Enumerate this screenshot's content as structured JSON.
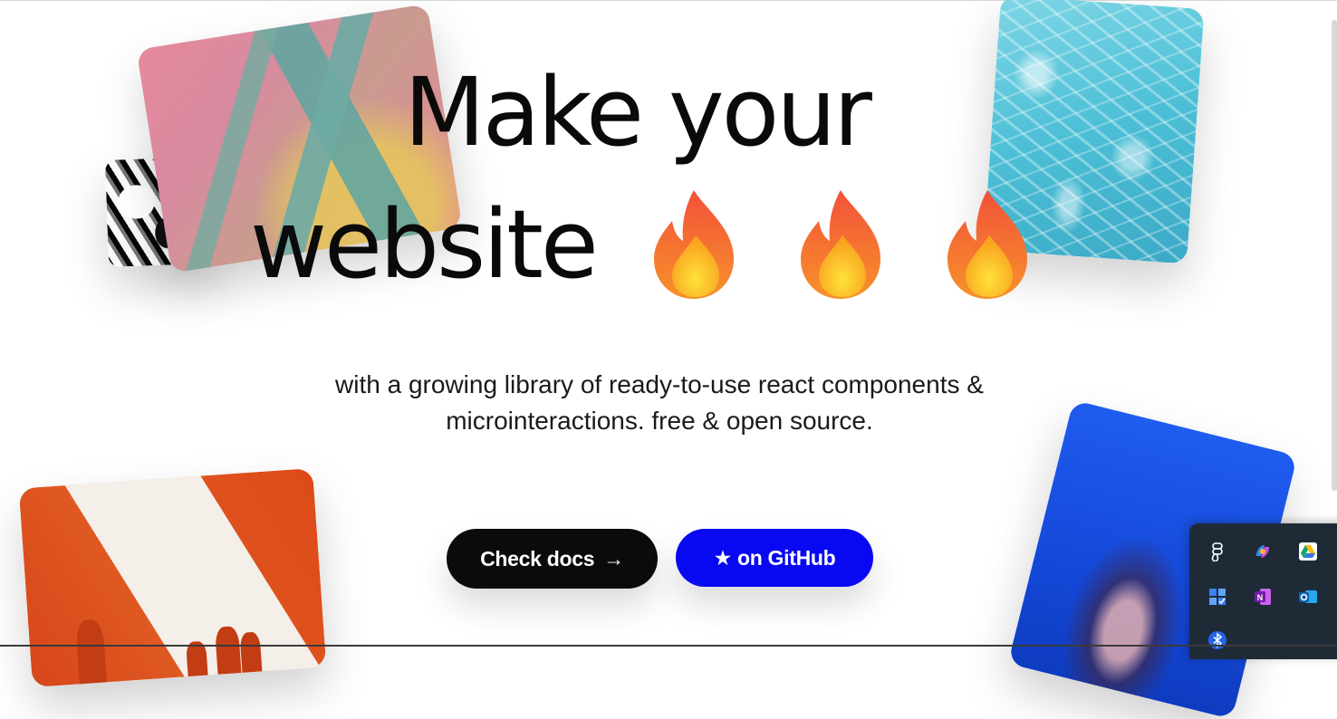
{
  "hero": {
    "title_line1": "Make your",
    "title_line2": "website",
    "flame_icons": [
      "fire-icon",
      "fire-icon",
      "fire-icon"
    ],
    "subtitle": "with a growing library of ready-to-use react components & microinteractions. free & open source."
  },
  "actions": {
    "docs_label": "Check docs",
    "docs_arrow": "→",
    "github_label": "★ on GitHub"
  },
  "tray_icons": [
    "figma-icon",
    "copilot-icon",
    "google-drive-icon",
    "task-manager-icon",
    "onenote-icon",
    "outlook-icon",
    "bluetooth-icon"
  ],
  "colors": {
    "docs_button": "#0b0b0b",
    "github_button": "#0808f2",
    "tray_background": "#1e2b37"
  }
}
